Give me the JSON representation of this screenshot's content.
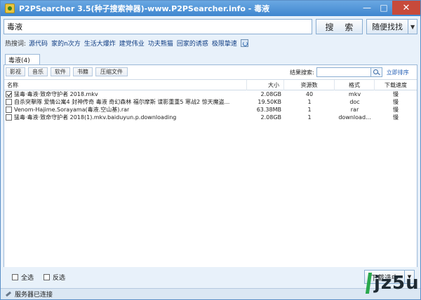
{
  "window": {
    "title": "P2PSearcher 3.5(种子搜索神器)-www.P2PSearcher.info - 毒液",
    "minimize": "—",
    "maximize": "□",
    "close": "✕"
  },
  "search": {
    "value": "毒液",
    "search_label": "搜 索",
    "random_label": "随便找找",
    "random_drop": "▼"
  },
  "hot": {
    "label": "热搜词:",
    "items": [
      "源代码",
      "家的n次方",
      "生活大爆炸",
      "建党伟业",
      "功夫熊猫",
      "回家的诱惑",
      "极限挚速"
    ]
  },
  "tab": {
    "label": "毒液(4)"
  },
  "filters": [
    "影视",
    "音乐",
    "软件",
    "书籍",
    "压缩文件"
  ],
  "result_search": {
    "label": "结果搜索:",
    "value": "",
    "sort_label": "立即排序"
  },
  "table": {
    "headers": [
      "名称",
      "大小",
      "资源数",
      "格式",
      "下载速度"
    ],
    "rows": [
      {
        "checked": true,
        "name": "猛毒·毒液·致命守护者 2018.mkv",
        "size": "2.08GB",
        "sources": "40",
        "format": "mkv",
        "speed": "慢"
      },
      {
        "checked": false,
        "name": "自杀突擊隊 爱情公寓4 封神传奇 毒液 奇幻森林 福尔摩斯 谍影重重5 寒战2 惊天魔盗...",
        "size": "19.50KB",
        "sources": "1",
        "format": "doc",
        "speed": "慢"
      },
      {
        "checked": false,
        "name": "Venom-Hajime.Sorayama(毒液.空山基).rar",
        "size": "63.38MB",
        "sources": "1",
        "format": "rar",
        "speed": "慢"
      },
      {
        "checked": false,
        "name": "猛毒·毒液·致命守护者 2018(1).mkv.baiduyun.p.downloading",
        "size": "2.08GB",
        "sources": "1",
        "format": "download...",
        "speed": "慢"
      }
    ]
  },
  "bottom": {
    "select_all": "全选",
    "invert": "反选",
    "download_label": "下载选中",
    "download_drop": "▼"
  },
  "status": {
    "text": "服务器已连接"
  },
  "watermark": {
    "text": "jz5u"
  }
}
